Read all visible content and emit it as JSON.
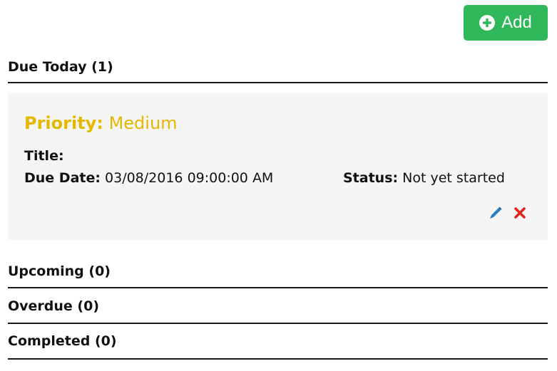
{
  "toolbar": {
    "add_label": "Add"
  },
  "sections": {
    "due_today": "Due Today (1)",
    "upcoming": "Upcoming (0)",
    "overdue": "Overdue (0)",
    "completed": "Completed (0)"
  },
  "task": {
    "priority_label": "Priority:",
    "priority_value": "Medium",
    "title_label": "Title:",
    "title_value": "",
    "due_date_label": "Due Date:",
    "due_date_value": "03/08/2016 09:00:00 AM",
    "status_label": "Status:",
    "status_value": "Not yet started"
  },
  "icons": {
    "add": "plus-circle-icon",
    "edit": "pencil-icon",
    "delete": "x-icon"
  },
  "colors": {
    "add_button": "#2fb85a",
    "priority_medium": "#e5b800",
    "edit_icon": "#2a7fc0",
    "delete_icon": "#e0231a",
    "card_background": "#f5f5f5"
  }
}
